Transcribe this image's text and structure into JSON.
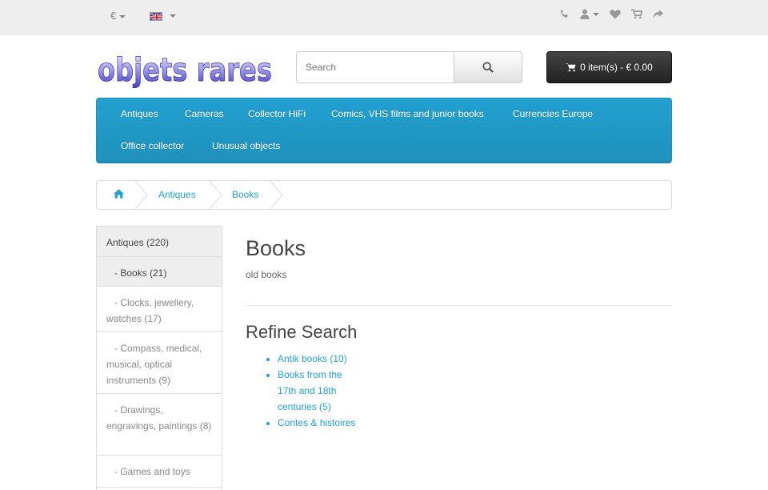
{
  "topbar": {
    "currency": "€",
    "language_flag": "uk-flag-icon",
    "icons": [
      "phone-icon",
      "user-icon",
      "heart-icon",
      "cart-icon",
      "share-icon"
    ]
  },
  "logo": {
    "text": "objets rares"
  },
  "search": {
    "placeholder": "Search"
  },
  "cart": {
    "label": "0 item(s) - € 0.00"
  },
  "menu": {
    "items": [
      "Antiques",
      "Cameras",
      "Collector HiFi",
      "Comics, VHS films and junior books",
      "Currencies Europe",
      "Office collector",
      "Unusual objects"
    ]
  },
  "breadcrumb": {
    "items": [
      "Antiques",
      "Books"
    ]
  },
  "sidebar": {
    "items": [
      {
        "label": "Antiques (220)",
        "active": true
      },
      {
        "label": "- Books (21)",
        "active": true
      },
      {
        "label": "- Clocks, jewellery, watches (17)",
        "active": false
      },
      {
        "label": "- Compass, medical, musical, optical instruments (9)",
        "active": false
      },
      {
        "label": "- Drawings, engravings, paintings (8)",
        "active": false
      },
      {
        "label": "- Games and toys",
        "active": false
      }
    ]
  },
  "main": {
    "title": "Books",
    "description": "old books",
    "refine_title": "Refine Search",
    "refine_items": [
      "Antik books (10)",
      "Books from the 17th and 18th centuries (5)",
      "Contes & histoires"
    ]
  },
  "colors": {
    "accent": "#23a1d1",
    "menu_bg": "#229ac8",
    "cart_bg": "#303030"
  }
}
